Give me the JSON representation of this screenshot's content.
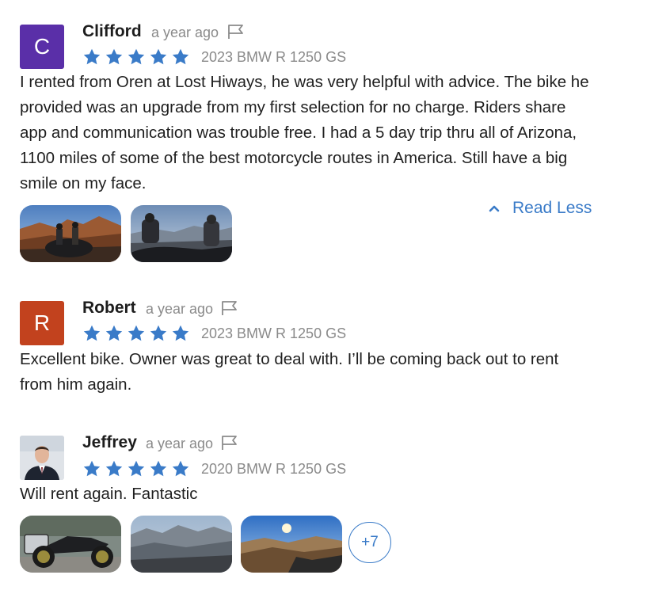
{
  "colors": {
    "star": "#3a7bc8",
    "link": "#3a7bc8",
    "avatar_c": "#5a2fa8",
    "avatar_r": "#c2421e"
  },
  "reviews": [
    {
      "name": "Clifford",
      "time": "a year ago",
      "avatar_letter": "C",
      "rating": 5,
      "vehicle": "2023 BMW R 1250 GS",
      "text": "I rented from Oren at Lost Hiways, he was very helpful with advice. The bike he provided was an upgrade from my first selection for no charge. Riders share app and communication was trouble free. I had a 5 day trip thru all of Arizona, 1100 miles of some of the best motorcycle routes in America. Still have a big smile on my face.",
      "read_less": "Read Less",
      "photos": [
        "desert-canyon-photo",
        "mountain-overlook-photo"
      ]
    },
    {
      "name": "Robert",
      "time": "a year ago",
      "avatar_letter": "R",
      "rating": 5,
      "vehicle": "2023 BMW R 1250 GS",
      "text": "Excellent bike. Owner was great to deal with. I’ll be coming back out to rent from him again."
    },
    {
      "name": "Jeffrey",
      "time": "a year ago",
      "avatar": "profile-photo",
      "rating": 5,
      "vehicle": "2020 BMW R 1250 GS",
      "text": "Will rent again. Fantastic",
      "photos": [
        "motorcycle-photo",
        "valley-view-photo",
        "hillside-sunset-photo"
      ],
      "more_photos": "+7"
    }
  ]
}
